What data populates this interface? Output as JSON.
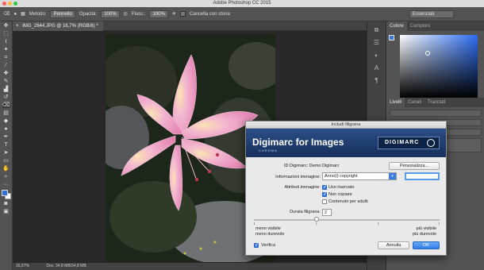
{
  "app": {
    "title": "Adobe Photoshop CC 2015"
  },
  "options_bar": {
    "method_label": "Metodo:",
    "method_value": "Pennello",
    "opacity_label": "Opacità:",
    "opacity_value": "100%",
    "flow_label": "Fluss.:",
    "flow_value": "100%",
    "erase_history_label": "Cancella con storia",
    "workspace": "Essenziali"
  },
  "document": {
    "tab_label": "IMG_2644.JPG @ 16,7% (RGB/8) *",
    "zoom": "16,67%",
    "doc_info": "Doc: 34,8 MB/34,8 MB"
  },
  "panels": {
    "color_tabs": [
      "Colore",
      "Campioni"
    ],
    "layer_tabs": [
      "Livelli",
      "Canali",
      "Tracciati"
    ]
  },
  "dialog": {
    "title": "Includi filigrana",
    "product": "Digimarc for Images",
    "product_sub": "CHROMA",
    "brand": "DIGIMARC",
    "id_label": "ID Digimarc: Demo Digimarc",
    "customize_button": "Personalizza...",
    "info_label": "Informazioni immagine:",
    "info_value": "Anno(i) copyright",
    "attr_label": "Attributi immagine:",
    "attr_options": [
      {
        "label": "Uso riservato",
        "checked": true
      },
      {
        "label": "Non copiare",
        "checked": true
      },
      {
        "label": "Contenuto per adulti",
        "checked": false
      }
    ],
    "duration_label": "Durata filigrana:",
    "duration_value": "2",
    "left_caption_1": "meno visibile",
    "left_caption_2": "meno durevole",
    "right_caption_1": "più visibile",
    "right_caption_2": "più durevole",
    "verify_label": "Verifica",
    "verify_checked": true,
    "cancel_button": "Annulla",
    "ok_button": "OK"
  }
}
